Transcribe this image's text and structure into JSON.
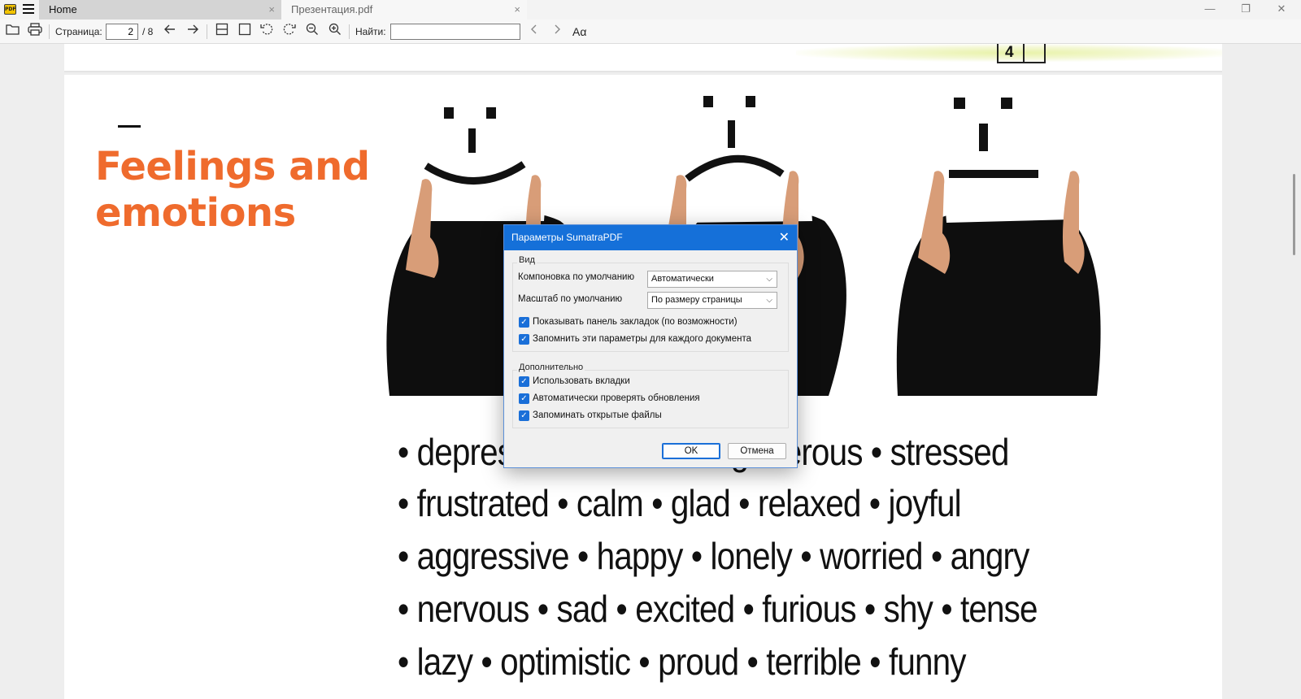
{
  "titlebar": {
    "app_icon": "sumatra-pdf-icon",
    "tabs": [
      {
        "label": "Home",
        "close": "×"
      },
      {
        "label": "Презентация.pdf",
        "close": "×"
      }
    ],
    "window_buttons": {
      "minimize": "—",
      "maximize": "❐",
      "close": "✕"
    }
  },
  "toolbar": {
    "page_label": "Страница:",
    "page_value": "2",
    "page_total": "/ 8",
    "find_label": "Найти:",
    "find_value": "",
    "icons": [
      "open-folder-icon",
      "print-icon",
      "arrow-left-icon",
      "arrow-right-icon",
      "single-page-icon",
      "fit-page-icon",
      "rotate-left-icon",
      "rotate-right-icon",
      "zoom-out-icon",
      "zoom-in-icon",
      "find-prev-icon",
      "find-next-icon",
      "match-case-icon"
    ],
    "match_case": "Aα"
  },
  "document": {
    "prev_page_number": "4",
    "slide_title_line1": "Feelings and",
    "slide_title_line2": "emotions",
    "title_color": "#ef6b2d",
    "word_lines": [
      "• depressed • cheerful • generous  • stressed",
      "• frustrated • calm • glad • relaxed • joyful",
      "• aggressive • happy • lonely • worried • angry",
      "• nervous • sad • excited • furious • shy • tense",
      "• lazy • optimistic • proud • terrible • funny"
    ]
  },
  "dialog": {
    "title": "Параметры SumatraPDF",
    "close": "✕",
    "view_group": {
      "label": "Вид",
      "layout_label": "Компоновка по умолчанию",
      "layout_value": "Автоматически",
      "zoom_label": "Масштаб по умолчанию",
      "zoom_value": "По размеру страницы",
      "checkboxes": [
        {
          "label": "Показывать панель закладок (по возможности)",
          "checked": true
        },
        {
          "label": "Запомнить эти параметры для каждого документа",
          "checked": true
        }
      ]
    },
    "advanced_group": {
      "label": "Дополнительно",
      "checkboxes": [
        {
          "label": "Использовать вкладки",
          "checked": true
        },
        {
          "label": "Автоматически проверять обновления",
          "checked": true
        },
        {
          "label": "Запоминать открытые файлы",
          "checked": true
        }
      ]
    },
    "ok_label": "OK",
    "cancel_label": "Отмена",
    "accent_color": "#1570d9"
  }
}
